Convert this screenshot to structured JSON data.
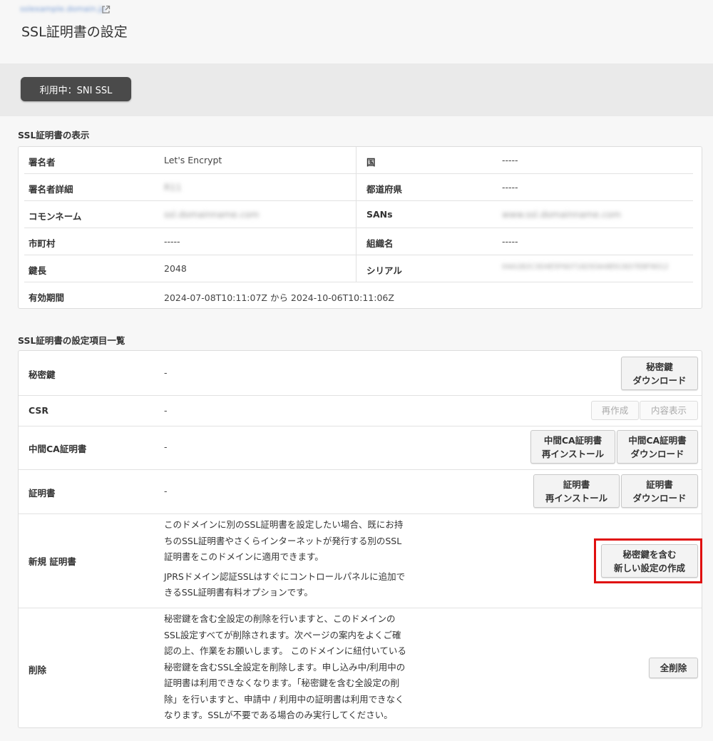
{
  "header": {
    "domain_link": "sslexample.domain.jp",
    "title": "SSL証明書の設定",
    "status_button": "利用中：SNI SSL"
  },
  "cert_section": {
    "title": "SSL証明書の表示",
    "rows": [
      {
        "l1": "署名者",
        "v1": "Let's Encrypt",
        "l2": "国",
        "v2": "-----"
      },
      {
        "l1": "署名者詳細",
        "v1": "R11",
        "l2": "都道府県",
        "v2": "-----"
      },
      {
        "l1": "コモンネーム",
        "v1": "ssl.domainname.com",
        "l2": "SANs",
        "v2": "www.ssl.domainname.com"
      },
      {
        "l1": "市町村",
        "v1": "-----",
        "l2": "組織名",
        "v2": "-----"
      },
      {
        "l1": "鍵長",
        "v1": "2048",
        "l2": "シリアル",
        "v2": "04A1B2C3D4E5F60718293A4B5C6D7E8F9012"
      },
      {
        "l1": "有効期間",
        "v1": "2024-07-08T10:11:07Z から 2024-10-06T10:11:06Z"
      }
    ]
  },
  "settings_section": {
    "title": "SSL証明書の設定項目一覧",
    "private_key": {
      "label": "秘密鍵",
      "value": "-",
      "btn_line1": "秘密鍵",
      "btn_line2": "ダウンロード"
    },
    "csr": {
      "label": "CSR",
      "value": "-",
      "btn_recreate": "再作成",
      "btn_view": "内容表示"
    },
    "intermediate": {
      "label": "中間CA証明書",
      "value": "-",
      "btn1_line1": "中間CA証明書",
      "btn1_line2": "再インストール",
      "btn2_line1": "中間CA証明書",
      "btn2_line2": "ダウンロード"
    },
    "certificate": {
      "label": "証明書",
      "value": "-",
      "btn1_line1": "証明書",
      "btn1_line2": "再インストール",
      "btn2_line1": "証明書",
      "btn2_line2": "ダウンロード"
    },
    "new_cert": {
      "label": "新規 証明書",
      "desc1_l1": "このドメインに別のSSL証明書を設定したい場合、既にお持",
      "desc1_l2": "ちのSSL証明書やさくらインターネットが発行する別のSSL",
      "desc1_l3": "証明書をこのドメインに適用できます。",
      "desc2_l1": "JPRSドメイン認証SSLはすぐにコントロールパネルに追加で",
      "desc2_l2": "きるSSL証明書有料オプションです。",
      "btn_line1": "秘密鍵を含む",
      "btn_line2": "新しい設定の作成"
    },
    "delete": {
      "label": "削除",
      "d1": "秘密鍵を含む全設定の削除を行いますと、このドメインの",
      "d2": "SSL設定すべてが削除されます。次ページの案内をよくご確",
      "d3": "認の上、作業をお願いします。 このドメインに紐付いている",
      "d4": "秘密鍵を含むSSL全設定を削除します。申し込み中/利用中の",
      "d5": "証明書は利用できなくなります。「秘密鍵を含む全設定の削",
      "d6": "除」を行いますと、申請中 / 利用中の証明書は利用できなく",
      "d7": "なります。SSLが不要である場合のみ実行してください。",
      "btn": "全削除"
    }
  },
  "colors": {
    "highlight": "#e01010",
    "status_button_bg": "#4a4a4a"
  }
}
